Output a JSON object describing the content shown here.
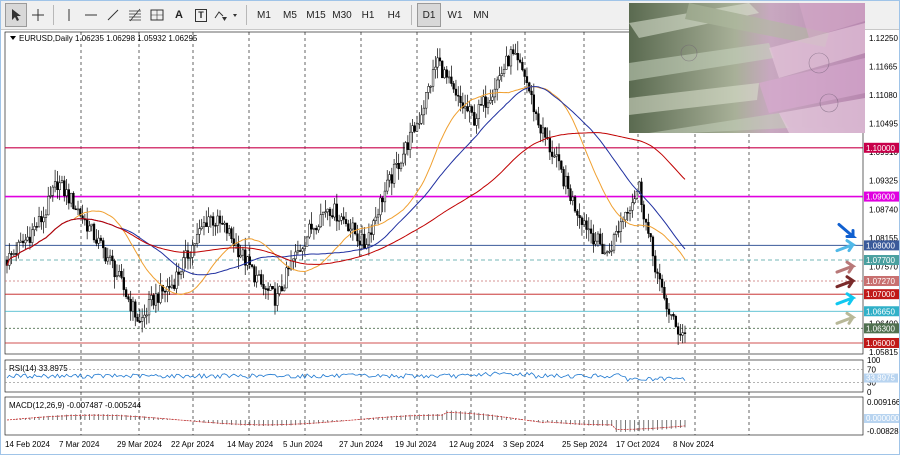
{
  "toolbar": {
    "tools": [
      {
        "name": "cursor-icon"
      },
      {
        "name": "crosshair-icon"
      },
      {
        "name": "vertical-line-icon"
      },
      {
        "name": "horizontal-line-icon"
      },
      {
        "name": "trendline-icon"
      },
      {
        "name": "fibonacci-icon"
      },
      {
        "name": "channel-icon"
      },
      {
        "name": "text-icon"
      },
      {
        "name": "text-label-icon"
      },
      {
        "name": "shapes-dropdown-icon"
      }
    ],
    "text_tool": "A",
    "text_label_tool": "T",
    "timeframes": [
      "M1",
      "M5",
      "M15",
      "M30",
      "H1",
      "H4",
      "D1",
      "W1",
      "MN"
    ],
    "active_timeframe": "D1"
  },
  "chart": {
    "header": "EURUSD,Daily  1.06235 1.06298 1.05932 1.06295",
    "price_labels": [
      "1.12250",
      "1.11665",
      "1.11080",
      "1.10495",
      "1.09910",
      "1.09325",
      "1.08740",
      "1.08155",
      "1.07570",
      "1.06985",
      "1.06400",
      "1.05815"
    ],
    "level_tags": [
      {
        "text": "1.10000",
        "bg": "#c8004a"
      },
      {
        "text": "1.09000",
        "bg": "#e000e0"
      },
      {
        "text": "1.08000",
        "bg": "#3a5a9a"
      },
      {
        "text": "1.07700",
        "bg": "#4aa0a0"
      },
      {
        "text": "1.07270",
        "bg": "#c87070"
      },
      {
        "text": "1.07000",
        "bg": "#c01818"
      },
      {
        "text": "1.06650",
        "bg": "#30b0c8"
      },
      {
        "text": "1.06300",
        "bg": "#507050"
      },
      {
        "text": "1.06000",
        "bg": "#c01818"
      }
    ],
    "date_labels": [
      "14 Feb 2024",
      "7 Mar 2024",
      "29 Mar 2024",
      "22 Apr 2024",
      "14 May 2024",
      "5 Jun 2024",
      "27 Jun 2024",
      "19 Jul 2024",
      "12 Aug 2024",
      "3 Sep 2024",
      "25 Sep 2024",
      "17 Oct 2024",
      "8 Nov 2024"
    ],
    "rsi_label": "RSI(14) 33.8975",
    "rsi_levels": [
      "100",
      "70",
      "30",
      "0"
    ],
    "rsi_tag": "33.8975",
    "macd_label": "MACD(12,26,9) -0.007487 -0.005244",
    "macd_levels": [
      "0.009166",
      "-0.00828"
    ],
    "macd_tag": "0.000000",
    "arrow_colors": [
      "#1060d0",
      "#4fb8e8",
      "#b87878",
      "#7a2a2a",
      "#10c8f0",
      "#b8b898"
    ],
    "colors": {
      "ma_long": "#c00000",
      "ma_mid": "#2030a0",
      "ma_short": "#f0a030",
      "rsi_line": "#1e78d0",
      "macd_line": "#c83030",
      "candle": "#000000"
    }
  },
  "photo": {
    "name": "money-photo"
  }
}
